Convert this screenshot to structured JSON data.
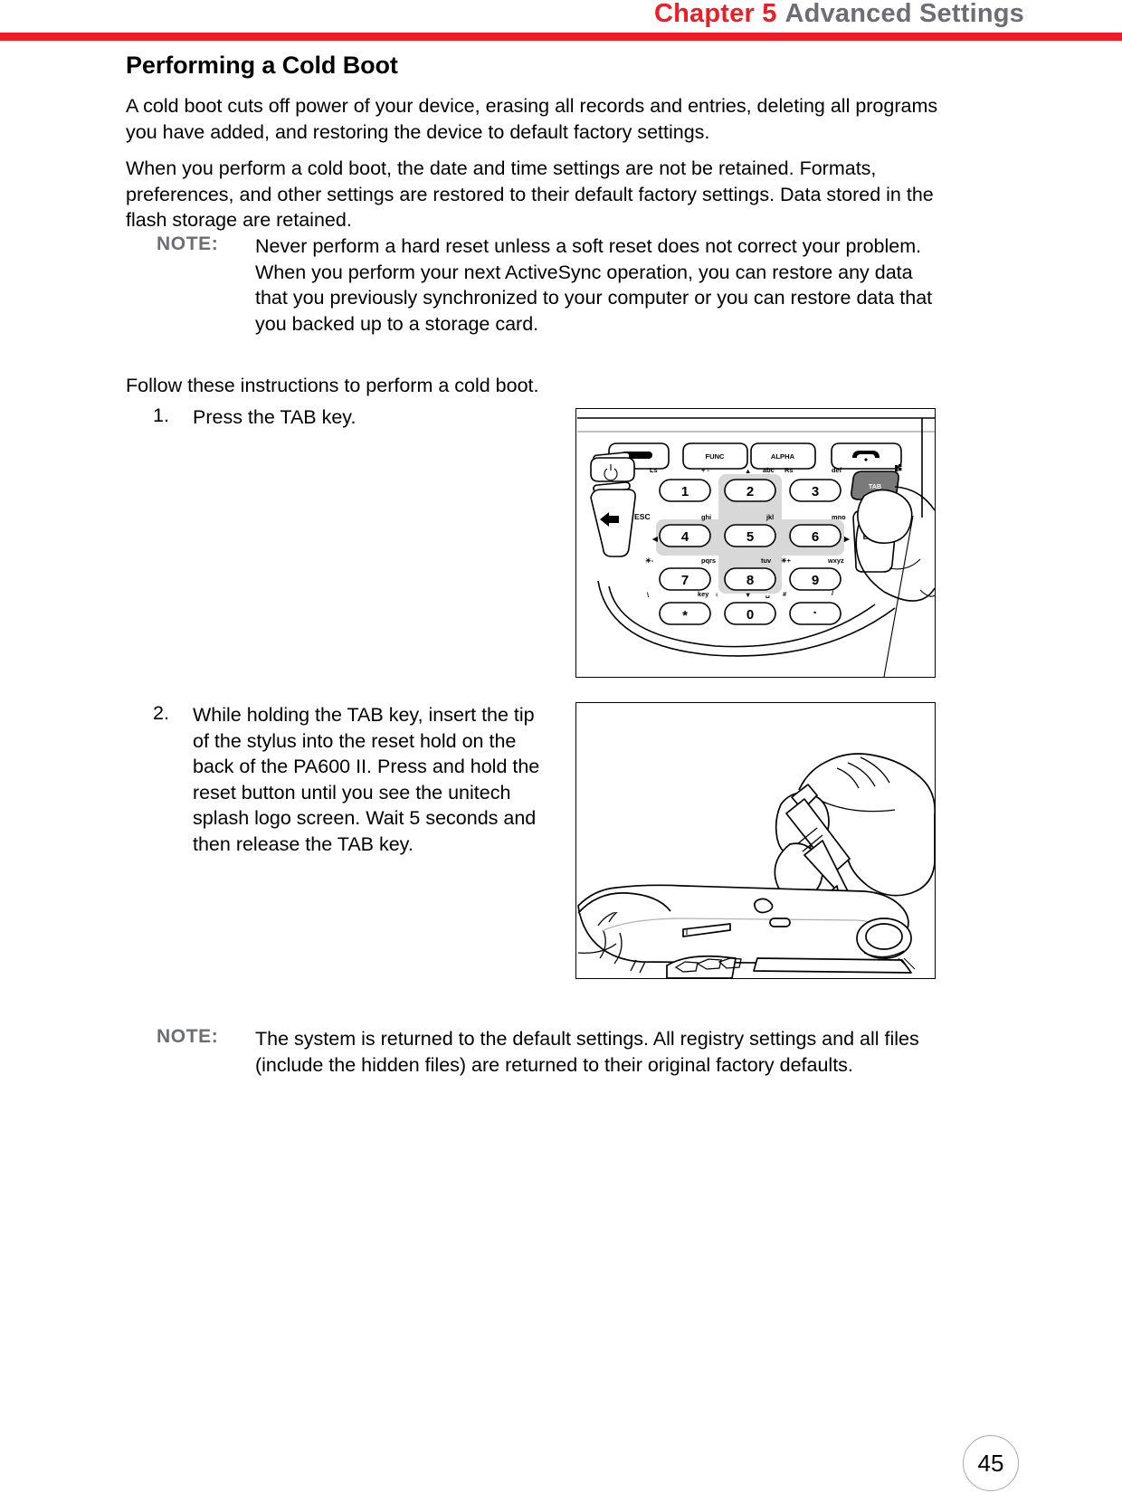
{
  "header": {
    "chapter": "Chapter 5",
    "section": "Advanced Settings",
    "rule_color": "#ee1c25",
    "section_color": "#6d6e71"
  },
  "heading": "Performing a Cold Boot",
  "paragraphs": {
    "intro": "A cold boot cuts off power of your device, erasing all records and entries, deleting all programs you have added, and restoring the device to default factory settings.",
    "details": "When you perform a cold boot, the date and time settings are not be retained. Formats, preferences, and other settings are restored to their default factory settings. Data stored in the flash storage are retained.",
    "follow": "Follow these instructions to perform a cold boot."
  },
  "notes": [
    {
      "label": "NOTE:",
      "text": "Never perform a hard reset unless a soft reset does not correct your problem. When you perform your next ActiveSync operation, you can restore any data that you previously synchronized to your computer or you can restore data that you backed up to a storage card."
    },
    {
      "label": "NOTE:",
      "text": "The system is returned to the default settings. All registry settings and all files (include the hidden files) are returned to their original factory defaults."
    }
  ],
  "steps": [
    {
      "number": "1.",
      "text": "Press the TAB key."
    },
    {
      "number": "2.",
      "text": "While holding the TAB key, insert the tip of the stylus into the reset hold on the back of the PA600 II. Press and hold the reset button until you see the unitech splash logo screen. Wait 5 seconds and then release the TAB key."
    }
  ],
  "figures": {
    "keypad": {
      "caption_keys": {
        "func": "FUNC",
        "alpha": "ALPHA",
        "tab": "TAB",
        "ent": "EN",
        "esc": "ESC"
      },
      "numeric_keys": [
        "1",
        "2",
        "3",
        "4",
        "5",
        "6",
        "7",
        "8",
        "9",
        "*",
        "0",
        "·"
      ],
      "key_hints": {
        "ls": "Ls",
        "plus_minus": "+ -",
        "up": "▲",
        "abc": "abc",
        "rs": "Rs",
        "def": "def",
        "ghi": "ghi",
        "jkl": "jkl",
        "mno": "mno",
        "pqrs": "pqrs",
        "tuv": "tuv",
        "wxyz": "wxyz",
        "key_light": "key",
        "down": "▼",
        "hash": "#",
        "slash": "/",
        "backslash": "\\",
        "bright_down": "☀-",
        "bright_up": "☀+",
        "left": "◀",
        "right": "▶"
      }
    },
    "stylus": {
      "description": "hand holding stylus pressing reset hole on back of device"
    }
  },
  "page_number": "45"
}
